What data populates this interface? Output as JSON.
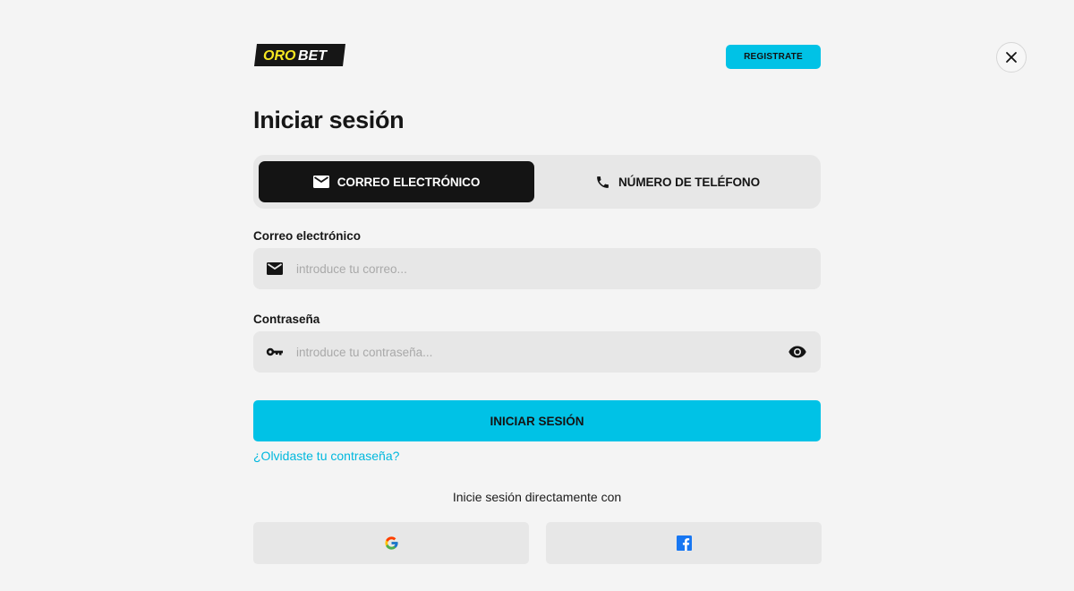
{
  "brand": {
    "logo_text": "OROBET",
    "logo_text_1": "ORO",
    "logo_text_2": "BET",
    "accent_color": "#00c2e6",
    "logo_yellow": "#f5e622"
  },
  "header": {
    "register_label": "REGISTRATE",
    "close_icon": "close-icon"
  },
  "title": "Iniciar sesión",
  "tabs": [
    {
      "label": "CORREO ELECTRÓNICO",
      "icon": "mail-icon",
      "active": true
    },
    {
      "label": "NÚMERO DE TELÉFONO",
      "icon": "phone-icon",
      "active": false
    }
  ],
  "email": {
    "label": "Correo electrónico",
    "placeholder": "introduce tu correo...",
    "value": "",
    "icon": "mail-icon"
  },
  "password": {
    "label": "Contraseña",
    "placeholder": "introduce tu contraseña...",
    "value": "",
    "icon": "key-icon",
    "toggle_icon": "eye-icon"
  },
  "login_label": "INICIAR SESIÓN",
  "forgot_label": "¿Olvidaste tu contraseña?",
  "social": {
    "text": "Inicie sesión directamente con",
    "providers": [
      {
        "name": "google",
        "icon": "google-icon"
      },
      {
        "name": "facebook",
        "icon": "facebook-icon"
      }
    ]
  }
}
